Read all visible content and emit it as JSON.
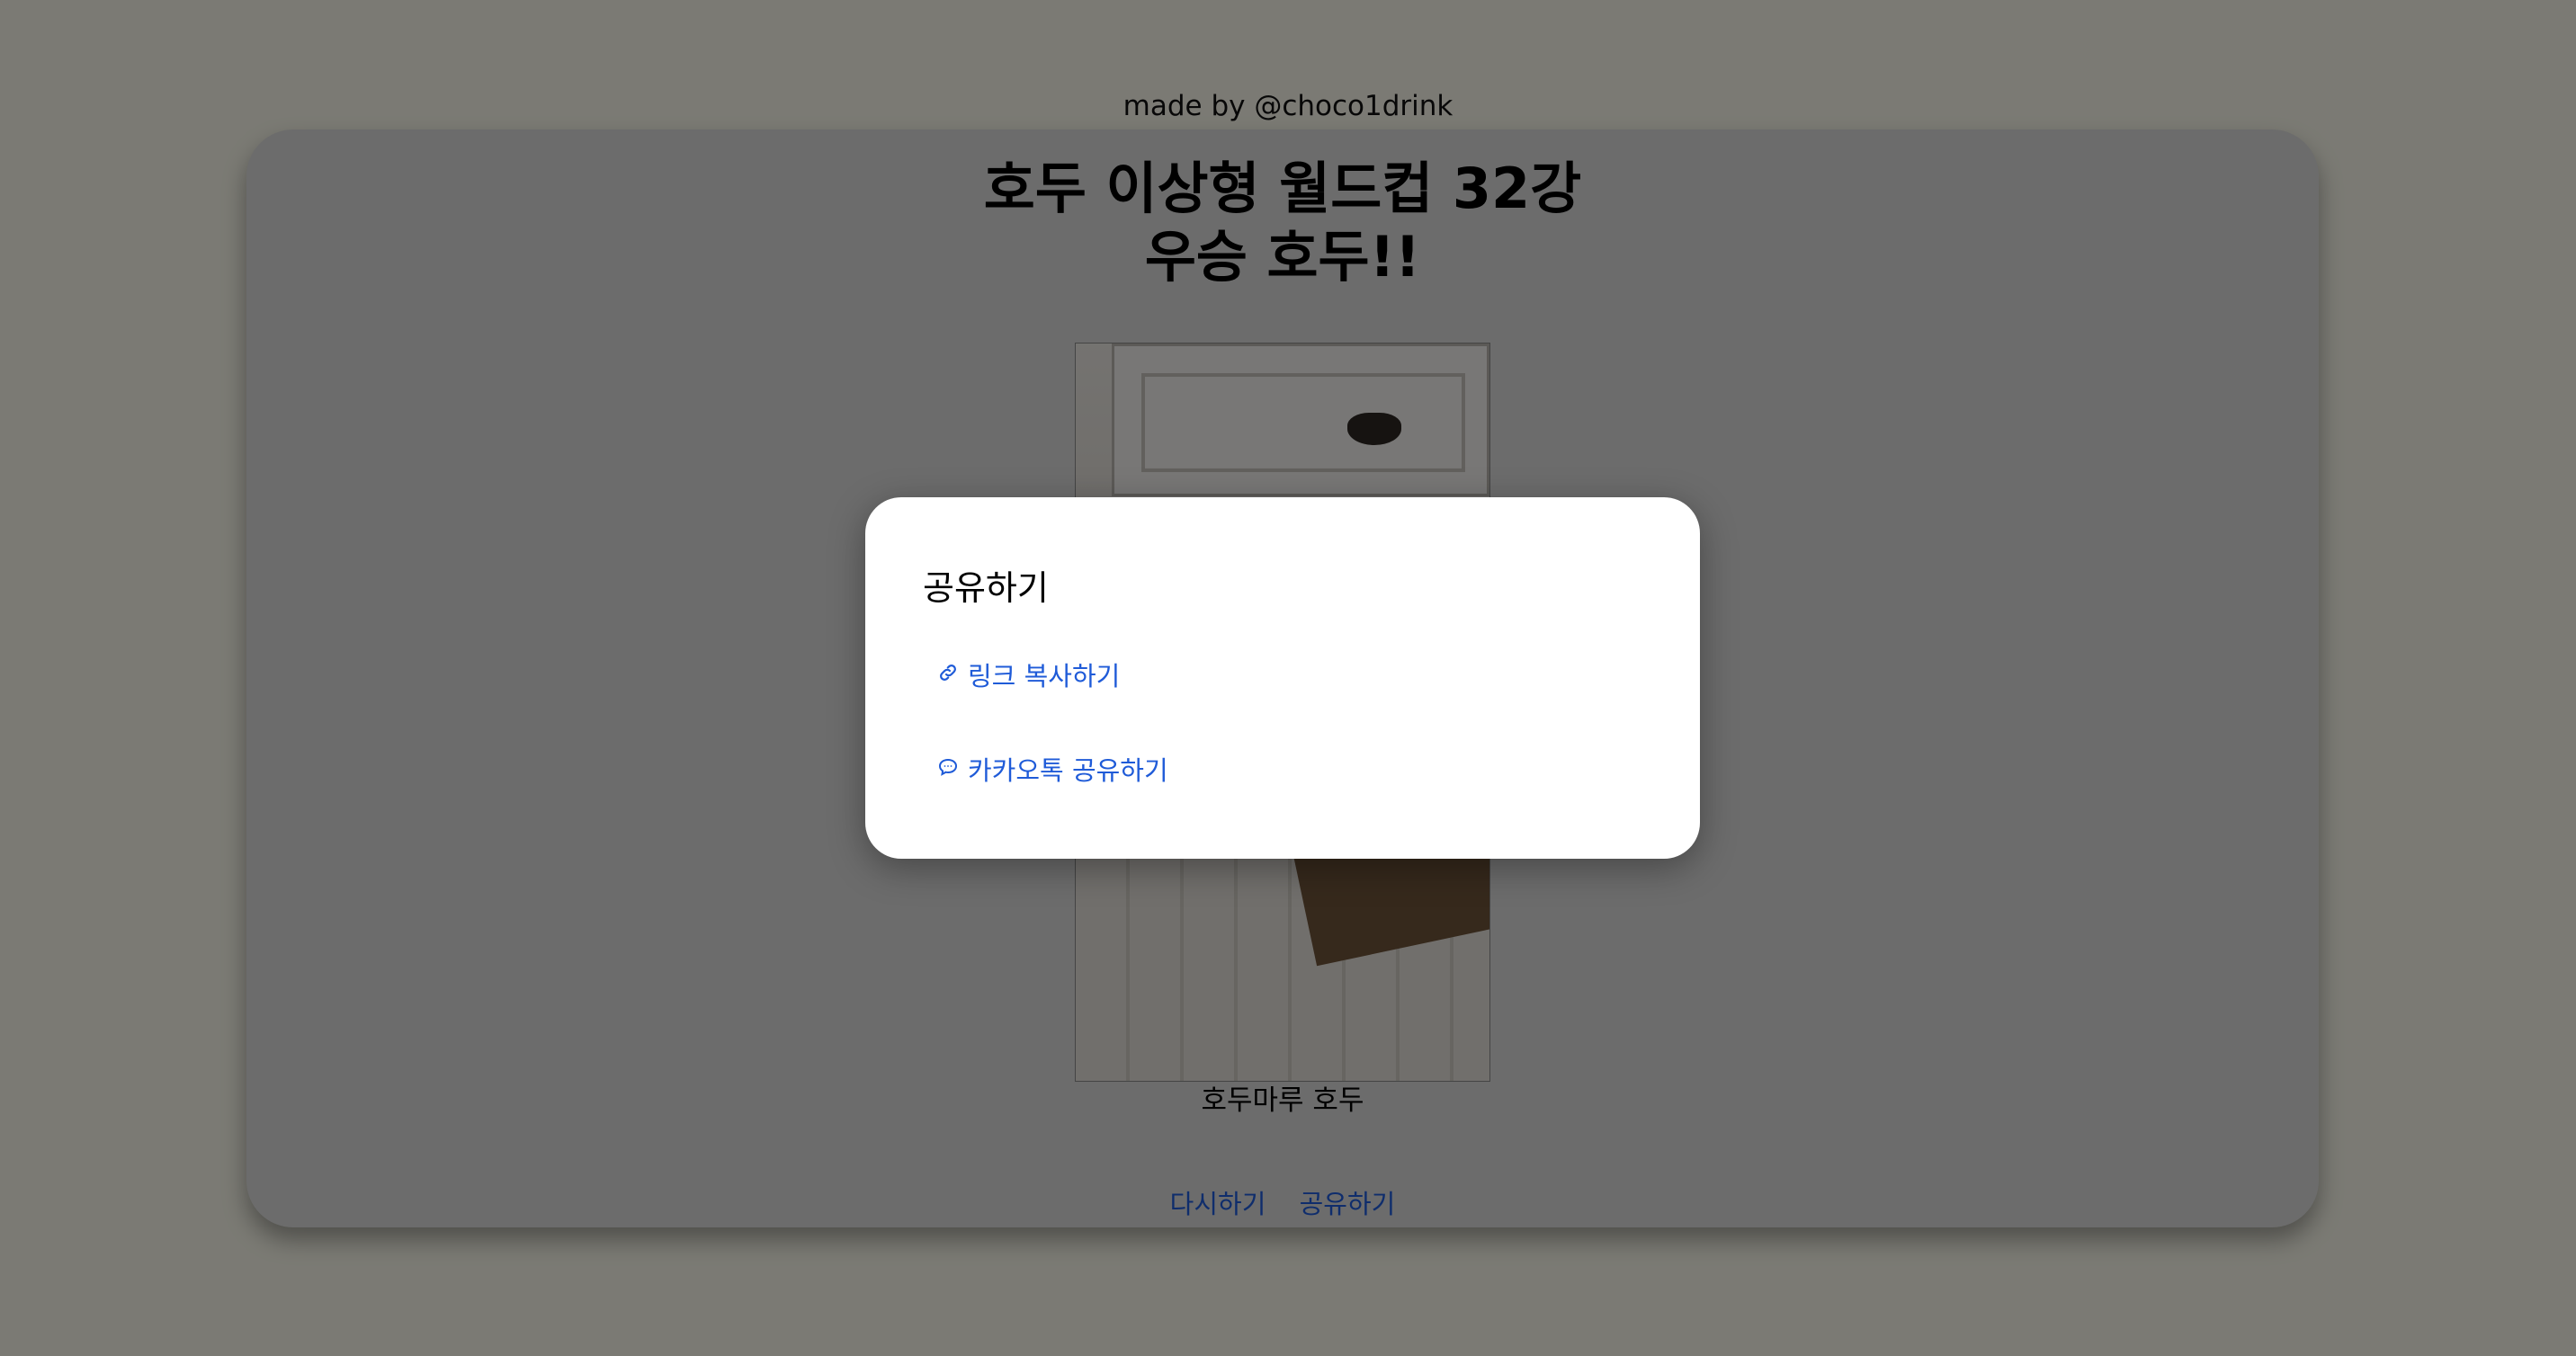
{
  "header": {
    "credit": "made by @choco1drink"
  },
  "result": {
    "title_line1": "호두 이상형 월드컵 32강",
    "title_line2": "우승 호두!!",
    "winner_name": "호두마루 호두"
  },
  "actions": {
    "retry_label": "다시하기",
    "share_label": "공유하기"
  },
  "share_modal": {
    "title": "공유하기",
    "options": [
      {
        "label": "링크 복사하기",
        "icon": "link-icon"
      },
      {
        "label": "카카오톡 공유하기",
        "icon": "chat-bubble-icon"
      }
    ]
  },
  "colors": {
    "page_background": "#f6f5e8",
    "card_background": "#d9d9d9",
    "link_blue": "#1f5bd8",
    "modal_background": "#ffffff"
  }
}
